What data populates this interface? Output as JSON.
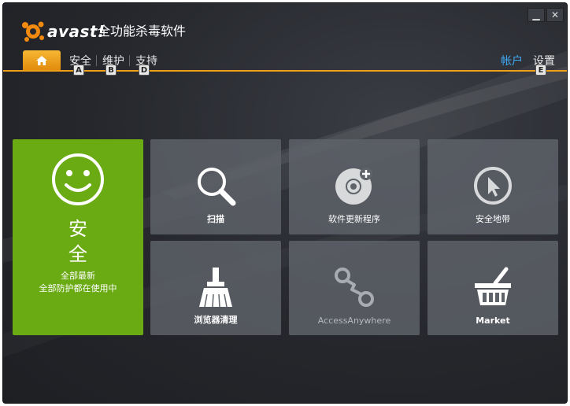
{
  "header": {
    "logo_text": "avast!",
    "app_title": "全功能杀毒软件",
    "minimize_symbol": "▁",
    "close_symbol": "✕"
  },
  "nav": {
    "items": [
      {
        "label": "安全",
        "key": "A"
      },
      {
        "label": "维护",
        "key": "B"
      },
      {
        "label": "支持",
        "key": "D"
      }
    ],
    "account_label": "帐户",
    "settings_label": "设置",
    "settings_key": "E",
    "account_color": "#3fa9f5",
    "accent_color": "#f0a018"
  },
  "status": {
    "title_line1": "安",
    "title_line2": "全",
    "line1": "全部最新",
    "line2": "全部防护都在使用中",
    "color": "#6aaa13"
  },
  "tiles": {
    "scan": {
      "label": "扫描",
      "icon": "magnifier-icon"
    },
    "software_updater": {
      "label": "软件更新程序",
      "icon": "disc-plus-icon"
    },
    "safezone": {
      "label": "安全地带",
      "icon": "cursor-circle-icon"
    },
    "browser_cleanup": {
      "label": "浏览器清理",
      "icon": "broom-icon"
    },
    "access_anywhere": {
      "label": "AccessAnywhere",
      "icon": "remote-link-icon"
    },
    "market": {
      "label": "Market",
      "icon": "basket-icon"
    }
  }
}
